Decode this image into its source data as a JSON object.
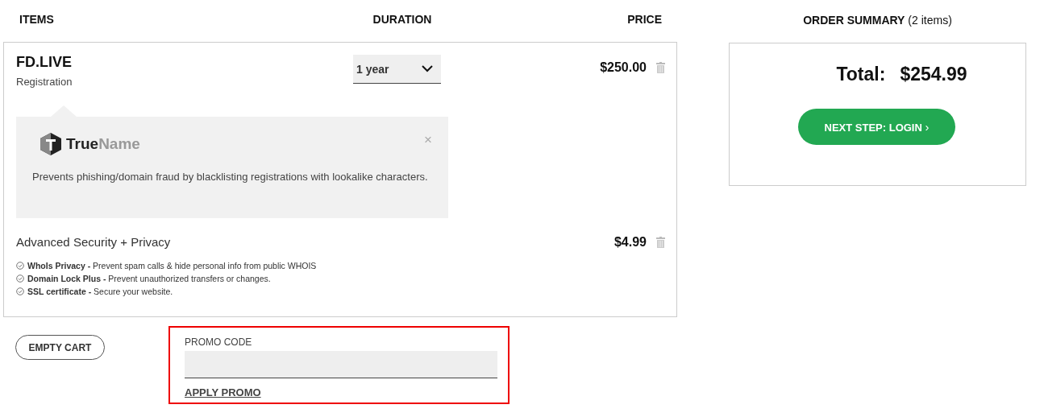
{
  "columns": [
    "ITEMS",
    "DURATION",
    "PRICE"
  ],
  "summary": {
    "title": "ORDER SUMMARY",
    "count": "(2 items)",
    "total_label": "Total:",
    "total": "$254.99",
    "next_button": "NEXT STEP: LOGIN",
    "next_caret": "›"
  },
  "items": [
    {
      "kind": "domain",
      "name": "FD.LIVE",
      "subtitle": "Registration",
      "duration": "1 year",
      "price": "$250.00",
      "notice": {
        "logo_parts": [
          "True",
          "Name"
        ],
        "close": "×",
        "text": "Prevents phishing/domain fraud by blacklisting registrations with lookalike characters."
      }
    },
    {
      "kind": "addon",
      "name": "Advanced Security + Privacy",
      "price": "$4.99",
      "features": [
        "**WhoIs Privacy -** Prevent spam calls & hide personal info from public WHOIS",
        "**Domain Lock Plus -** Prevent unauthorized transfers or changes.",
        "**SSL certificate -** Secure your website."
      ]
    }
  ],
  "empty_cart": "EMPTY CART",
  "promo": {
    "label": "PROMO CODE",
    "apply": "APPLY PROMO",
    "highlighted": true
  }
}
